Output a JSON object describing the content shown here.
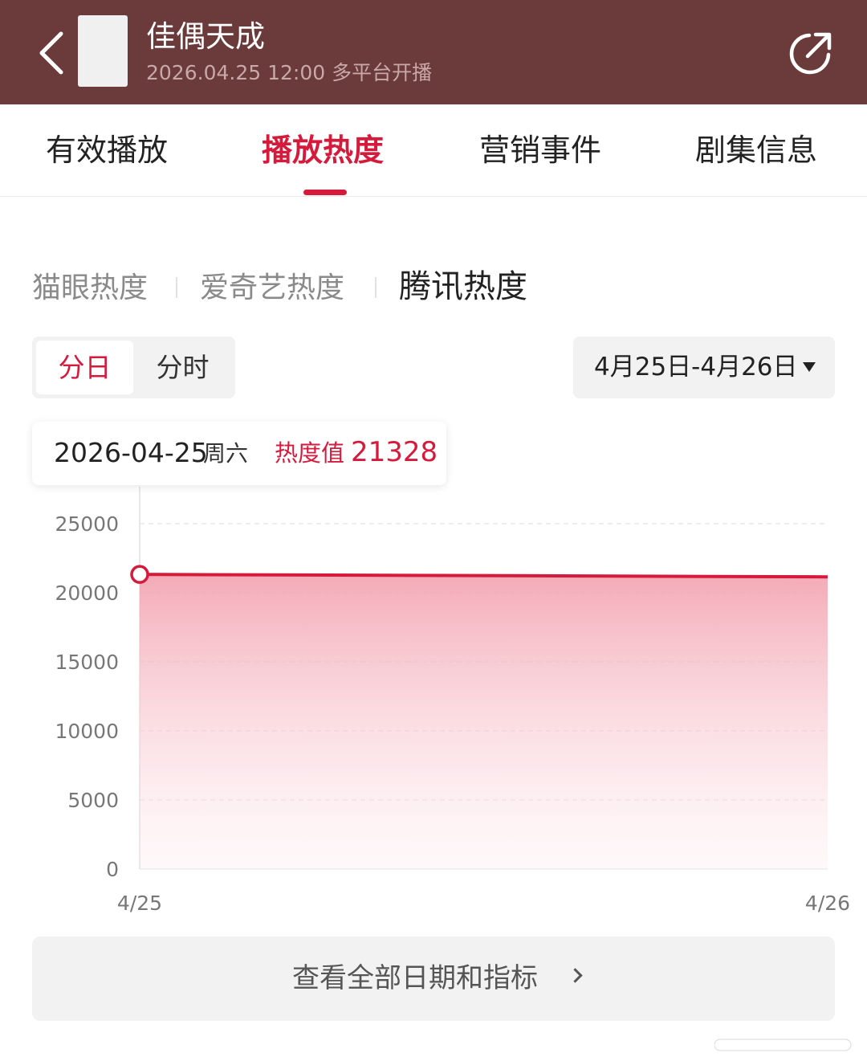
{
  "header": {
    "title": "佳偶天成",
    "subtitle": "2026.04.25 12:00 多平台开播",
    "icons": {
      "back": "back-arrow-icon",
      "share": "share-icon"
    }
  },
  "tabs": [
    {
      "label": "有效播放",
      "active": false
    },
    {
      "label": "播放热度",
      "active": true
    },
    {
      "label": "营销事件",
      "active": false
    },
    {
      "label": "剧集信息",
      "active": false
    }
  ],
  "sources": [
    {
      "label": "猫眼热度",
      "active": false
    },
    {
      "label": "爱奇艺热度",
      "active": false
    },
    {
      "label": "腾讯热度",
      "active": true
    }
  ],
  "granularity": [
    {
      "label": "分日",
      "active": true
    },
    {
      "label": "分时",
      "active": false
    }
  ],
  "date_range": {
    "label": "4月25日-4月26日"
  },
  "tooltip": {
    "date": "2026-04-25",
    "weekday": "周六",
    "label": "热度值",
    "value": "21328"
  },
  "chart_data": {
    "type": "area",
    "x": [
      "4/25",
      "4/26"
    ],
    "series": [
      {
        "values": [
          21328,
          21150
        ]
      }
    ],
    "y_ticks": [
      "25000",
      "20000",
      "15000",
      "10000",
      "5000",
      "0"
    ],
    "ylim": [
      0,
      25000
    ],
    "grid": true,
    "color": "#d61a3c"
  },
  "footer": {
    "view_all_label": "查看全部日期和指标"
  },
  "colors": {
    "header_bg": "#6b3a3a",
    "accent": "#d61a3c"
  }
}
